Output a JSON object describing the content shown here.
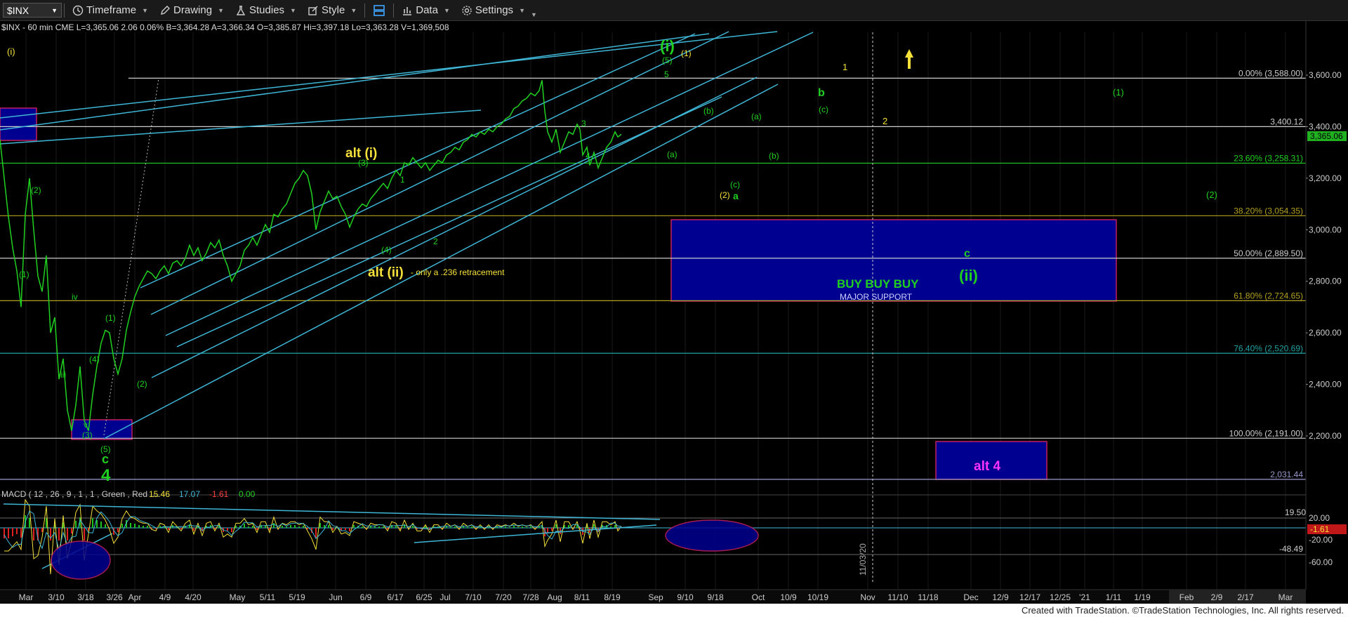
{
  "toolbar": {
    "symbol": "$INX",
    "timeframe_label": "Timeframe",
    "drawing_label": "Drawing",
    "studies_label": "Studies",
    "style_label": "Style",
    "data_label": "Data",
    "settings_label": "Settings"
  },
  "info_line": "$INX - 60 min  CME  L=3,365.06  2.06  0.06%  B=3,364.28  A=3,366.34  O=3,385.87  Hi=3,397.18  Lo=3,363.28  V=1,369,508",
  "macd_label": "MACD ( 12 , 26 , 9 , 1 , 1 , Green , Red ....",
  "macd_values": [
    "15.46",
    "17.07",
    "-1.61",
    "0.00"
  ],
  "footer": "Created with TradeStation. ©TradeStation Technologies, Inc. All rights reserved.",
  "colors": {
    "price": "#20d020",
    "channel": "#3fb6d6",
    "zone": "#00008c",
    "zone_border": "#d0306a",
    "yellow": "#f5e13a",
    "alt4": "#ff33ff"
  },
  "chart_data": {
    "type": "line",
    "title": "$INX - 60 min",
    "xlabel": "",
    "ylabel": "",
    "ylim": [
      1900,
      3760
    ],
    "y_ticks": [
      "3,600.00",
      "3,400.00",
      "3,200.00",
      "3,000.00",
      "2,800.00",
      "2,600.00",
      "2,400.00",
      "2,200.00"
    ],
    "x_ticks": [
      "Mar",
      "3/10",
      "3/18",
      "3/26",
      "Apr",
      "4/9",
      "4/20",
      "May",
      "5/11",
      "5/19",
      "Jun",
      "6/9",
      "6/17",
      "6/25",
      "Jul",
      "7/10",
      "7/20",
      "7/28",
      "Aug",
      "8/11",
      "8/19",
      "Sep",
      "9/10",
      "9/18",
      "Oct",
      "10/9",
      "10/19",
      "Nov",
      "11/10",
      "11/18",
      "Dec",
      "12/9",
      "12/17",
      "12/25",
      "'21",
      "1/11",
      "1/19",
      "Feb",
      "2/9",
      "2/17",
      "Mar"
    ],
    "last_price_label": "3,365.06",
    "levels": [
      {
        "label": "0.00% (3,588.00)",
        "value": 3588.0
      },
      {
        "label": "3,400.12",
        "value": 3400.12
      },
      {
        "label": "23.60% (3,258.31)",
        "value": 3258.31
      },
      {
        "label": "38.20% (3,054.35)",
        "value": 3054.35
      },
      {
        "label": "50.00% (2,889.50)",
        "value": 2889.5
      },
      {
        "label": "61.80% (2,724.65)",
        "value": 2724.65
      },
      {
        "label": "76.40% (2,520.69)",
        "value": 2520.69
      },
      {
        "label": "100.00% (2,191.00)",
        "value": 2191.0
      },
      {
        "label": "2,031.44",
        "value": 2031.44
      }
    ],
    "series": [
      {
        "name": "$INX",
        "values": [
          [
            0,
            3350
          ],
          [
            6,
            3200
          ],
          [
            12,
            3050
          ],
          [
            18,
            2930
          ],
          [
            24,
            2840
          ],
          [
            30,
            2700
          ],
          [
            36,
            3060
          ],
          [
            42,
            3200
          ],
          [
            48,
            3000
          ],
          [
            54,
            2820
          ],
          [
            60,
            2760
          ],
          [
            66,
            2900
          ],
          [
            72,
            2600
          ],
          [
            78,
            2660
          ],
          [
            84,
            2420
          ],
          [
            90,
            2500
          ],
          [
            96,
            2300
          ],
          [
            102,
            2220
          ],
          [
            108,
            2320
          ],
          [
            114,
            2470
          ],
          [
            120,
            2260
          ],
          [
            126,
            2220
          ],
          [
            132,
            2360
          ],
          [
            138,
            2470
          ],
          [
            144,
            2560
          ],
          [
            150,
            2610
          ],
          [
            156,
            2600
          ],
          [
            162,
            2500
          ],
          [
            168,
            2440
          ],
          [
            174,
            2500
          ],
          [
            180,
            2610
          ],
          [
            186,
            2680
          ],
          [
            192,
            2740
          ],
          [
            198,
            2780
          ],
          [
            204,
            2810
          ],
          [
            210,
            2840
          ],
          [
            216,
            2830
          ],
          [
            222,
            2810
          ],
          [
            228,
            2840
          ],
          [
            234,
            2860
          ],
          [
            240,
            2830
          ],
          [
            246,
            2870
          ],
          [
            252,
            2880
          ],
          [
            258,
            2860
          ],
          [
            264,
            2890
          ],
          [
            270,
            2940
          ],
          [
            276,
            2900
          ],
          [
            282,
            2930
          ],
          [
            288,
            2880
          ],
          [
            294,
            2910
          ],
          [
            300,
            2950
          ],
          [
            306,
            2930
          ],
          [
            312,
            2960
          ],
          [
            318,
            2900
          ],
          [
            324,
            2860
          ],
          [
            330,
            2800
          ],
          [
            336,
            2830
          ],
          [
            342,
            2860
          ],
          [
            348,
            2920
          ],
          [
            354,
            2940
          ],
          [
            360,
            2970
          ],
          [
            366,
            2940
          ],
          [
            372,
            2980
          ],
          [
            378,
            3020
          ],
          [
            384,
            2990
          ],
          [
            390,
            3060
          ],
          [
            396,
            3050
          ],
          [
            402,
            3080
          ],
          [
            408,
            3100
          ],
          [
            414,
            3140
          ],
          [
            420,
            3180
          ],
          [
            426,
            3200
          ],
          [
            432,
            3230
          ],
          [
            438,
            3210
          ],
          [
            444,
            3140
          ],
          [
            450,
            3000
          ],
          [
            456,
            3070
          ],
          [
            462,
            3110
          ],
          [
            468,
            3150
          ],
          [
            474,
            3120
          ],
          [
            480,
            3130
          ],
          [
            486,
            3090
          ],
          [
            492,
            3060
          ],
          [
            498,
            3010
          ],
          [
            504,
            3050
          ],
          [
            510,
            3080
          ],
          [
            516,
            3100
          ],
          [
            522,
            3090
          ],
          [
            528,
            3120
          ],
          [
            534,
            3140
          ],
          [
            540,
            3160
          ],
          [
            546,
            3180
          ],
          [
            552,
            3160
          ],
          [
            558,
            3200
          ],
          [
            564,
            3230
          ],
          [
            570,
            3210
          ],
          [
            576,
            3260
          ],
          [
            582,
            3250
          ],
          [
            588,
            3280
          ],
          [
            594,
            3260
          ],
          [
            600,
            3240
          ],
          [
            606,
            3260
          ],
          [
            612,
            3230
          ],
          [
            618,
            3250
          ],
          [
            624,
            3270
          ],
          [
            630,
            3260
          ],
          [
            636,
            3290
          ],
          [
            642,
            3300
          ],
          [
            648,
            3320
          ],
          [
            654,
            3310
          ],
          [
            660,
            3340
          ],
          [
            666,
            3350
          ],
          [
            672,
            3370
          ],
          [
            678,
            3360
          ],
          [
            684,
            3380
          ],
          [
            690,
            3370
          ],
          [
            696,
            3390
          ],
          [
            702,
            3380
          ],
          [
            708,
            3400
          ],
          [
            714,
            3410
          ],
          [
            720,
            3430
          ],
          [
            726,
            3440
          ],
          [
            732,
            3470
          ],
          [
            738,
            3480
          ],
          [
            744,
            3500
          ],
          [
            750,
            3510
          ],
          [
            756,
            3530
          ],
          [
            762,
            3520
          ],
          [
            768,
            3540
          ],
          [
            772,
            3580
          ],
          [
            776,
            3460
          ],
          [
            780,
            3380
          ],
          [
            786,
            3340
          ],
          [
            792,
            3390
          ],
          [
            798,
            3300
          ],
          [
            804,
            3340
          ],
          [
            810,
            3380
          ],
          [
            816,
            3370
          ],
          [
            822,
            3410
          ],
          [
            826,
            3390
          ],
          [
            830,
            3290
          ],
          [
            836,
            3320
          ],
          [
            840,
            3250
          ],
          [
            846,
            3300
          ],
          [
            852,
            3240
          ],
          [
            858,
            3280
          ],
          [
            864,
            3320
          ],
          [
            870,
            3340
          ],
          [
            876,
            3380
          ],
          [
            880,
            3360
          ],
          [
            885,
            3370
          ]
        ]
      }
    ],
    "macd": {
      "name": "MACD",
      "values": [
        15.46,
        17.07,
        -1.61,
        0.0
      ],
      "y_ticks": [
        "19.50",
        "20.00",
        "-1.61",
        "-20.00",
        "-48.49",
        "-60.00"
      ]
    },
    "annotations": [
      {
        "text": "alt (i)"
      },
      {
        "text": "alt (ii)"
      },
      {
        "text": "- only a .236 retracement"
      },
      {
        "text": "(i)"
      },
      {
        "text": "(ii)"
      },
      {
        "text": "BUY BUY BUY"
      },
      {
        "text": "MAJOR SUPPORT"
      },
      {
        "text": "alt 4"
      },
      {
        "text": "c"
      },
      {
        "text": "4"
      },
      {
        "text": "a"
      },
      {
        "text": "b"
      },
      {
        "text": "11/03/20"
      }
    ]
  }
}
